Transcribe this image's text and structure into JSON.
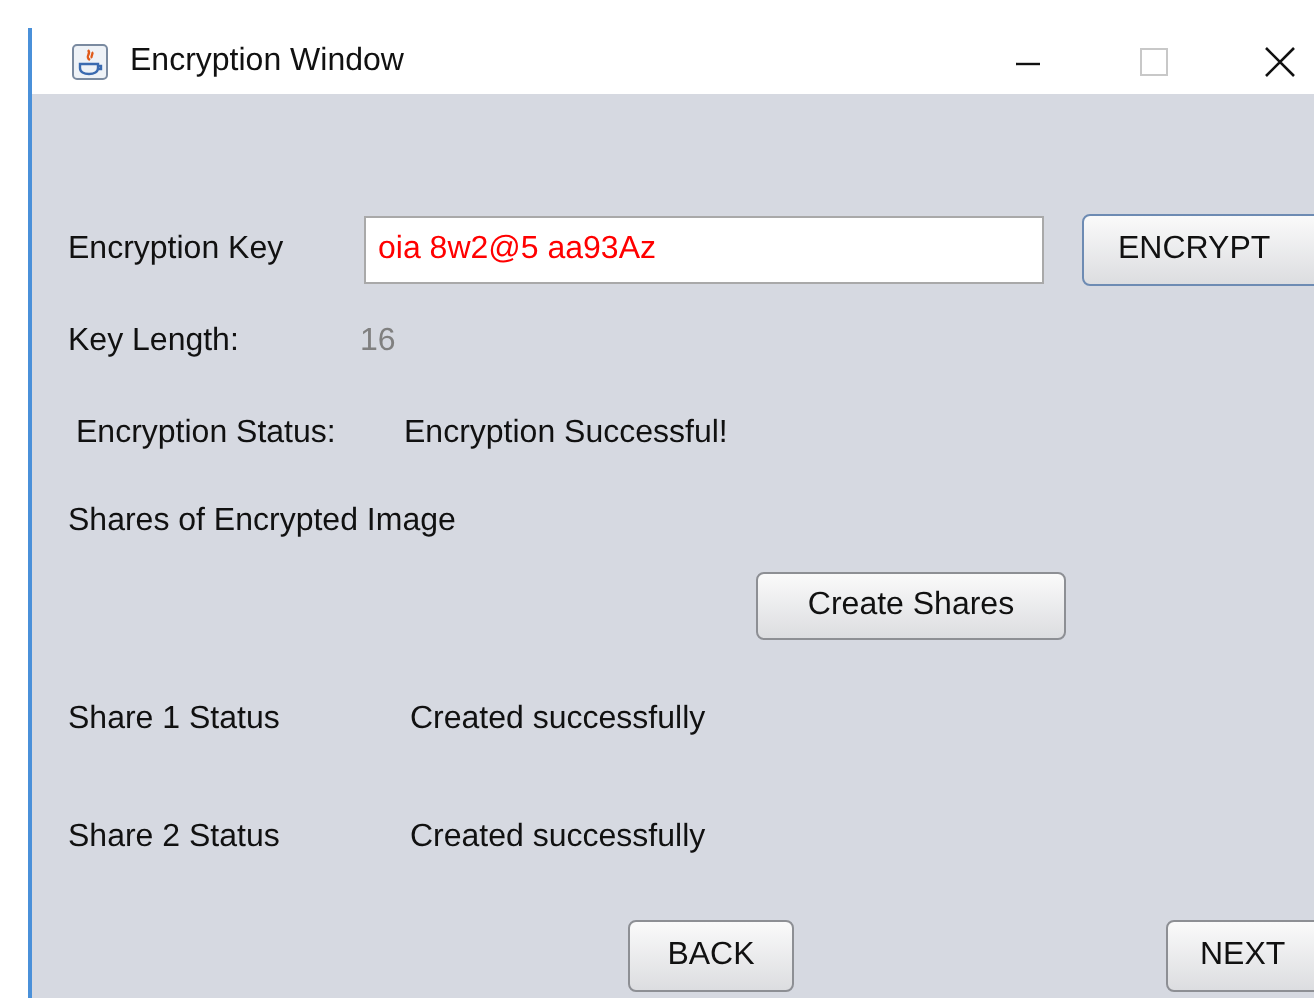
{
  "window": {
    "title": "Encryption Window"
  },
  "key": {
    "label": "Encryption Key",
    "value": "oia 8w2@5 aa93Az",
    "button": "ENCRYPT"
  },
  "key_length": {
    "label": "Key Length:",
    "value": "16"
  },
  "status": {
    "label": "Encryption Status:",
    "value": "Encryption Successful!"
  },
  "shares_heading": "Shares of Encrypted Image",
  "create_button": "Create Shares",
  "shares": [
    {
      "label": "Share 1 Status",
      "value": "Created successfully"
    },
    {
      "label": "Share 2 Status",
      "value": "Created successfully"
    }
  ],
  "buttons": [
    "BACK",
    "NEXT"
  ]
}
